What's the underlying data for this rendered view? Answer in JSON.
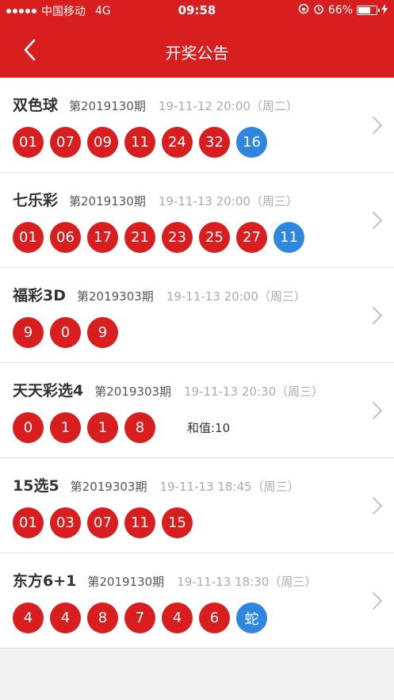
{
  "status_bar": {
    "carrier": "中国移动",
    "network": "4G",
    "time": "09:58",
    "battery": "66%",
    "battery_level": 0.66
  },
  "nav": {
    "title": "开奖公告"
  },
  "lotteries": [
    {
      "name": "双色球",
      "issue": "第2019130期",
      "time": "19-11-12 20:00（周二）",
      "red": [
        "01",
        "07",
        "09",
        "11",
        "24",
        "32"
      ],
      "blue": [
        "16"
      ],
      "extra": ""
    },
    {
      "name": "七乐彩",
      "issue": "第2019130期",
      "time": "19-11-13 20:00（周三）",
      "red": [
        "01",
        "06",
        "17",
        "21",
        "23",
        "25",
        "27"
      ],
      "blue": [
        "11"
      ],
      "extra": ""
    },
    {
      "name": "福彩3D",
      "issue": "第2019303期",
      "time": "19-11-13 20:00（周三）",
      "red": [
        "9",
        "0",
        "9"
      ],
      "blue": [],
      "extra": ""
    },
    {
      "name": "天天彩选4",
      "issue": "第2019303期",
      "time": "19-11-13 20:30（周三）",
      "red": [
        "0",
        "1",
        "1",
        "8"
      ],
      "blue": [],
      "extra": "和值:10"
    },
    {
      "name": "15选5",
      "issue": "第2019303期",
      "time": "19-11-13 18:45（周三）",
      "red": [
        "01",
        "03",
        "07",
        "11",
        "15"
      ],
      "blue": [],
      "extra": ""
    },
    {
      "name": "东方6+1",
      "issue": "第2019130期",
      "time": "19-11-13 18:30（周三）",
      "red": [
        "4",
        "4",
        "8",
        "7",
        "4",
        "6"
      ],
      "blue": [
        "蛇"
      ],
      "extra": ""
    }
  ],
  "colors": {
    "brand_red": "#d81e1e",
    "ball_blue": "#2f86de",
    "chevron_gray": "#bbbbbb"
  }
}
